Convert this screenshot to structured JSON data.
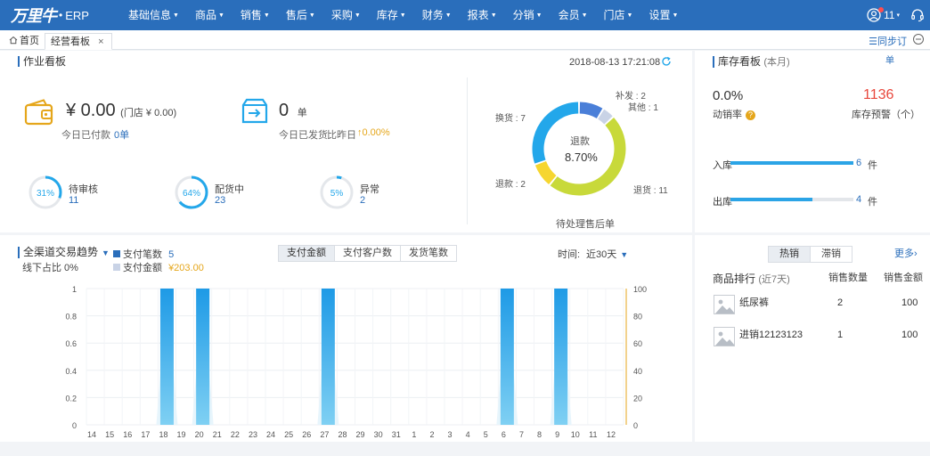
{
  "app": {
    "logo": "万里牛",
    "dot": "•",
    "name": "ERP"
  },
  "nav": [
    "基础信息",
    "商品",
    "销售",
    "售后",
    "采购",
    "库存",
    "财务",
    "报表",
    "分销",
    "会员",
    "门店",
    "设置"
  ],
  "user": {
    "count": "11"
  },
  "tabs": {
    "home": "首页",
    "active": "经营看板",
    "close": "×",
    "sync": "同步订"
  },
  "work": {
    "title": "作业看板",
    "datetime": "2018-08-13 17:21:08",
    "paid_amount": "¥ 0.00",
    "store_paid": "(门店 ¥ 0.00)",
    "paid_label": "今日已付款",
    "paid_count": "0单",
    "shipped_count": "0",
    "shipped_unit": "单",
    "shipped_label": "今日已发货",
    "compare_label": "比昨日",
    "compare_value": "↑0.00%",
    "rings": [
      {
        "pct": "31%",
        "ratio": 0.31,
        "label": "待审核",
        "num": "11"
      },
      {
        "pct": "64%",
        "ratio": 0.64,
        "label": "配货中",
        "num": "23"
      },
      {
        "pct": "5%",
        "ratio": 0.05,
        "label": "异常",
        "num": "2"
      }
    ],
    "donut": {
      "center_label": "退款",
      "center_value": "8.70%",
      "caption": "待处理售后单",
      "slices": [
        {
          "name": "补发",
          "value": 2,
          "label": "补发 : 2",
          "color": "#4a7fd8"
        },
        {
          "name": "其他",
          "value": 1,
          "label": "其他 : 1",
          "color": "#c9d3e6"
        },
        {
          "name": "退货",
          "value": 11,
          "label": "退货 : 11",
          "color": "#c8d93a"
        },
        {
          "name": "退款",
          "value": 2,
          "label": "退款 : 2",
          "color": "#f6d630"
        },
        {
          "name": "换货",
          "value": 7,
          "label": "换货 : 7",
          "color": "#23a7ea"
        }
      ]
    }
  },
  "stock": {
    "title": "库存看板",
    "title_sub": "(本月)",
    "unit_top": "单",
    "rate": "0.0%",
    "rate_label": "动销率",
    "help": "?",
    "warn": "1136",
    "warn_label": "库存预警（个）",
    "in_label": "入库",
    "in_value": "6",
    "in_ratio": 1.0,
    "out_label": "出库",
    "out_value": "4",
    "out_ratio": 0.67,
    "unit": "件"
  },
  "trend": {
    "title": "全渠道交易趋势",
    "offline": "线下占比 0%",
    "legend": [
      {
        "label": "支付笔数",
        "value": "5",
        "color": "#2a6ebb",
        "value_color": "#2a6ebb"
      },
      {
        "label": "支付金额",
        "value": "¥203.00",
        "color": "#c9d3e6",
        "value_color": "#e5a61b"
      }
    ],
    "metrics": [
      "支付金额",
      "支付客户数",
      "发货笔数"
    ],
    "time_label": "时间:",
    "time_value": "近30天"
  },
  "chart_data": {
    "type": "bar",
    "categories": [
      "14",
      "15",
      "16",
      "17",
      "18",
      "19",
      "20",
      "21",
      "22",
      "23",
      "24",
      "25",
      "26",
      "27",
      "28",
      "29",
      "30",
      "31",
      "1",
      "2",
      "3",
      "4",
      "5",
      "6",
      "7",
      "8",
      "9",
      "10",
      "11",
      "12"
    ],
    "series": [
      {
        "name": "支付笔数",
        "axis": "left",
        "values": [
          0,
          0,
          0,
          0,
          1,
          0,
          1,
          0,
          0,
          0,
          0,
          0,
          0,
          1,
          0,
          0,
          0,
          0,
          0,
          0,
          0,
          0,
          0,
          1,
          0,
          0,
          1,
          0,
          0,
          0
        ]
      }
    ],
    "y_left": {
      "ticks": [
        "1",
        "0.8",
        "0.6",
        "0.4",
        "0.2",
        "0"
      ],
      "min": 0,
      "max": 1
    },
    "y_right": {
      "ticks": [
        "100",
        "80",
        "60",
        "40",
        "20",
        "0"
      ],
      "min": 0,
      "max": 100
    },
    "grid": true
  },
  "rank": {
    "tabs": [
      "热销",
      "滞销"
    ],
    "more": "更多›",
    "title": "商品排行",
    "title_sub": "(近7天)",
    "col_qty": "销售数量",
    "col_amount": "销售金额",
    "items": [
      {
        "name": "纸尿裤",
        "qty": "2",
        "amount": "100"
      },
      {
        "name": "进销12123123",
        "qty": "1",
        "amount": "100"
      }
    ]
  },
  "colors": {
    "nav": "#2a6ebb",
    "accent": "#23a7ea",
    "warn": "#e8473c",
    "orange": "#e5a61b"
  },
  "icons": [
    "wallet-icon",
    "shipping-box-icon",
    "refresh-icon",
    "user-icon",
    "headset-icon",
    "home-icon",
    "sync-icon",
    "image-placeholder-icon"
  ]
}
